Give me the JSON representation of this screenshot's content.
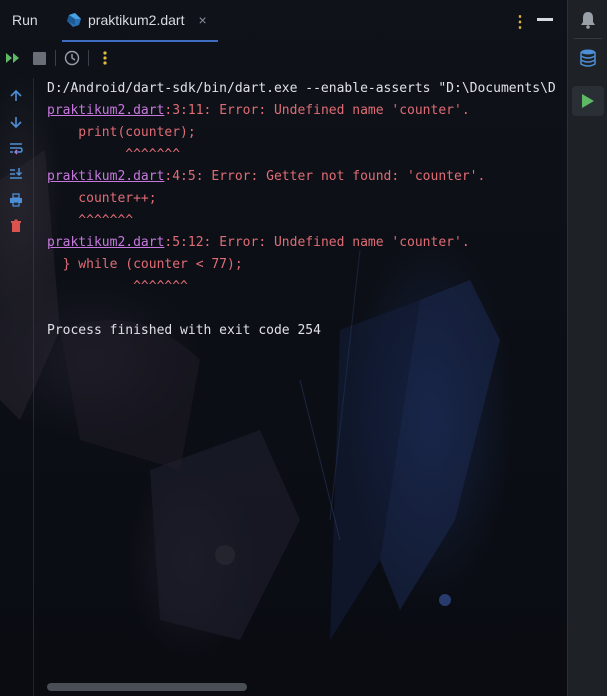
{
  "header": {
    "run_title": "Run",
    "tab_label": "praktikum2.dart",
    "tab_close": "×"
  },
  "console": {
    "lines": [
      {
        "parts": [
          {
            "text": "D:/Android/dart-sdk/bin/dart.exe --enable-asserts \"D:\\Documents\\D",
            "style": "plain"
          }
        ]
      },
      {
        "parts": [
          {
            "text": "praktikum2.dart",
            "style": "link"
          },
          {
            "text": ":3:11: Error: Undefined name 'counter'.",
            "style": "err"
          }
        ]
      },
      {
        "parts": [
          {
            "text": "    print(counter);",
            "style": "err"
          }
        ]
      },
      {
        "parts": [
          {
            "text": "          ^^^^^^^",
            "style": "err"
          }
        ]
      },
      {
        "parts": [
          {
            "text": "praktikum2.dart",
            "style": "link"
          },
          {
            "text": ":4:5: Error: Getter not found: 'counter'.",
            "style": "err"
          }
        ]
      },
      {
        "parts": [
          {
            "text": "    counter++;",
            "style": "err"
          }
        ]
      },
      {
        "parts": [
          {
            "text": "    ^^^^^^^",
            "style": "err"
          }
        ]
      },
      {
        "parts": [
          {
            "text": "praktikum2.dart",
            "style": "link"
          },
          {
            "text": ":5:12: Error: Undefined name 'counter'.",
            "style": "err"
          }
        ]
      },
      {
        "parts": [
          {
            "text": "  } while (counter < 77);",
            "style": "err"
          }
        ]
      },
      {
        "parts": [
          {
            "text": "           ^^^^^^^",
            "style": "err"
          }
        ]
      },
      {
        "parts": [
          {
            "text": "",
            "style": "plain"
          }
        ]
      },
      {
        "parts": [
          {
            "text": "Process finished with exit code 254",
            "style": "plain"
          }
        ]
      }
    ]
  },
  "icons": {
    "rerun": "rerun-icon",
    "stop": "stop-icon",
    "history": "history-icon",
    "more": "more-options-icon",
    "up": "arrow-up-icon",
    "down": "arrow-down-icon",
    "wrap": "soft-wrap-icon",
    "scroll_end": "scroll-to-end-icon",
    "print": "print-icon",
    "trash": "trash-icon",
    "bell": "notifications-icon",
    "database": "database-icon",
    "run": "run-icon"
  },
  "colors": {
    "error": "#e06c75",
    "link": "#c678dd",
    "plain": "#dfe1e6",
    "accent_green": "#5fb865",
    "accent_yellow": "#e2b93d",
    "accent_blue": "#4d8fd6"
  }
}
